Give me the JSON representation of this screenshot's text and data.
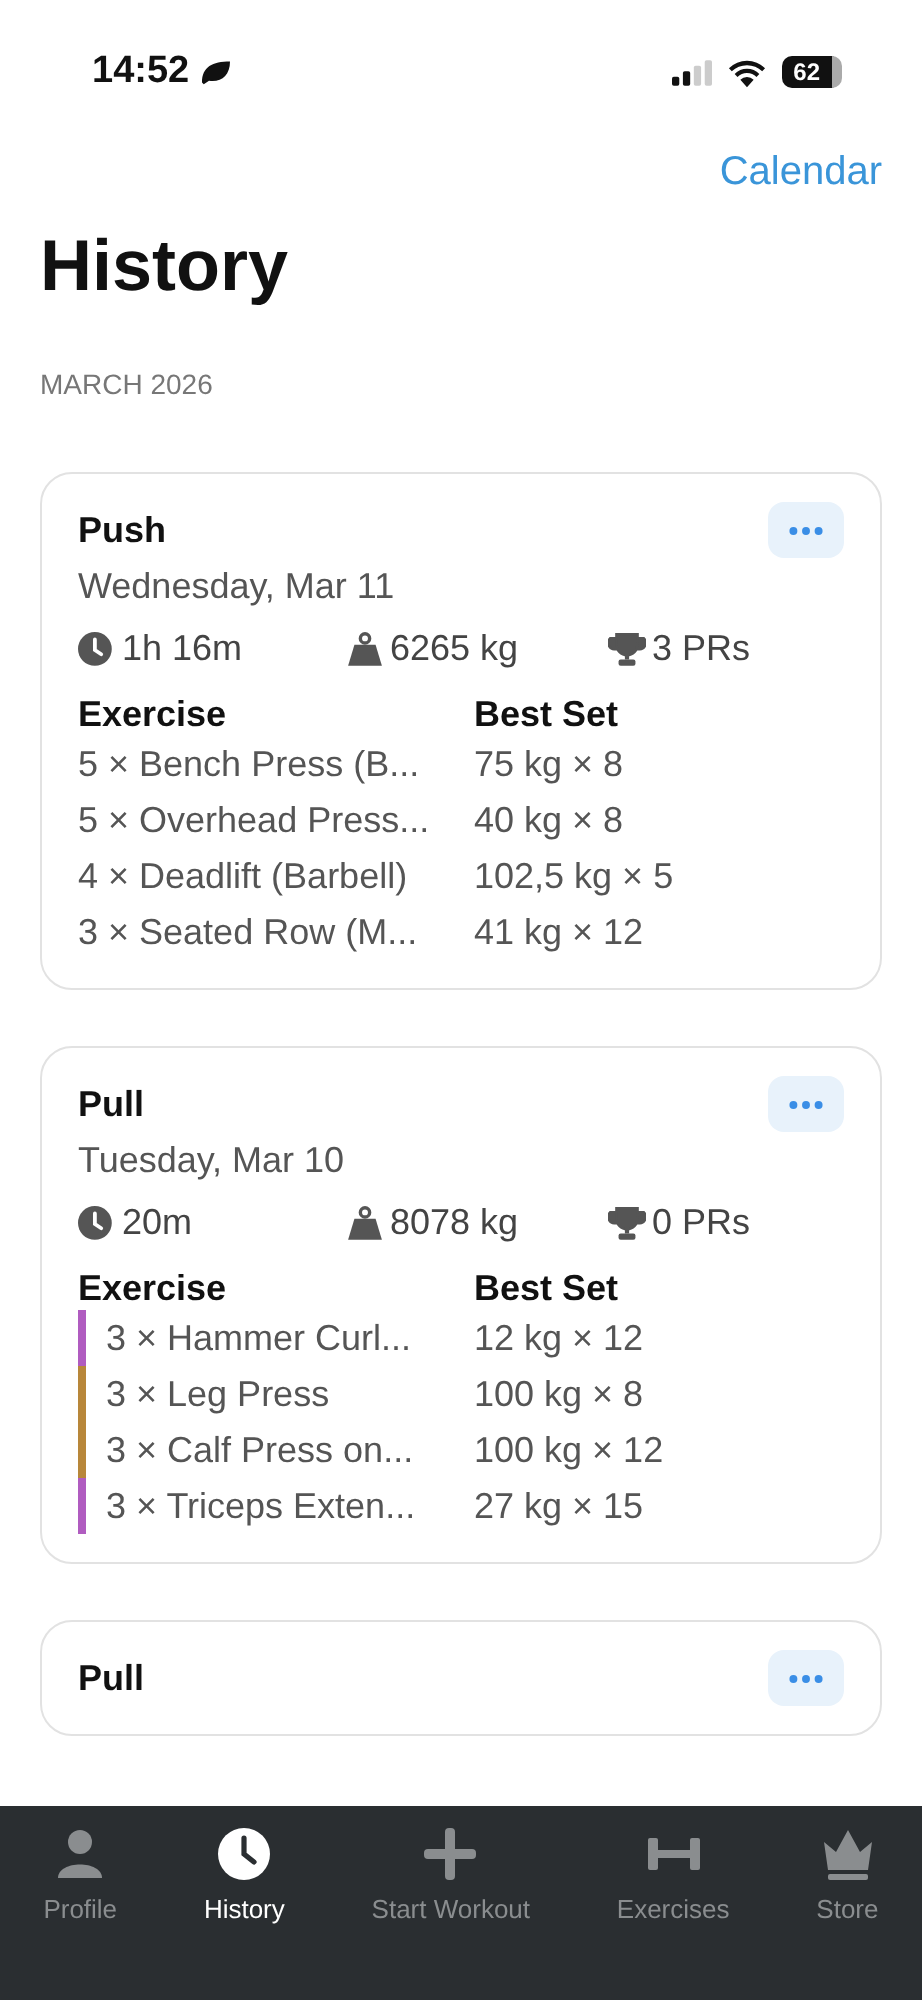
{
  "status_bar": {
    "time": "14:52",
    "battery": "62"
  },
  "nav": {
    "calendar_link": "Calendar"
  },
  "title": "History",
  "section_header": "MARCH 2026",
  "workouts": [
    {
      "name": "Push",
      "date": "Wednesday, Mar 11",
      "duration": "1h 16m",
      "volume": "6265 kg",
      "prs": "3 PRs",
      "columns": [
        "Exercise",
        "Best Set"
      ],
      "exercises": [
        {
          "name": "5 × Bench Press (B...",
          "best_set": "75 kg × 8"
        },
        {
          "name": "5 × Overhead Press...",
          "best_set": "40 kg × 8"
        },
        {
          "name": "4 × Deadlift (Barbell)",
          "best_set": "102,5 kg × 5"
        },
        {
          "name": "3 × Seated Row (M...",
          "best_set": "41 kg × 12"
        }
      ]
    },
    {
      "name": "Pull",
      "date": "Tuesday, Mar 10",
      "duration": "20m",
      "volume": "8078 kg",
      "prs": "0 PRs",
      "columns": [
        "Exercise",
        "Best Set"
      ],
      "exercises": [
        {
          "name": "3 × Hammer Curl...",
          "best_set": "12 kg × 12",
          "color": "#b05cc0"
        },
        {
          "name": "3 × Leg Press",
          "best_set": "100 kg × 8",
          "color": "#b8873a"
        },
        {
          "name": "3 × Calf Press on...",
          "best_set": "100 kg × 12",
          "color": "#b8873a"
        },
        {
          "name": "3 × Triceps Exten...",
          "best_set": "27 kg × 15",
          "color": "#b05cc0"
        }
      ]
    },
    {
      "name": "Pull"
    }
  ],
  "tab_bar": [
    {
      "label": "Profile",
      "kind": "profile",
      "selected": false
    },
    {
      "label": "History",
      "kind": "history",
      "selected": true
    },
    {
      "label": "Start Workout",
      "kind": "plus",
      "selected": false
    },
    {
      "label": "Exercises",
      "kind": "dumbbell",
      "selected": false
    },
    {
      "label": "Store",
      "kind": "crown",
      "selected": false
    }
  ]
}
